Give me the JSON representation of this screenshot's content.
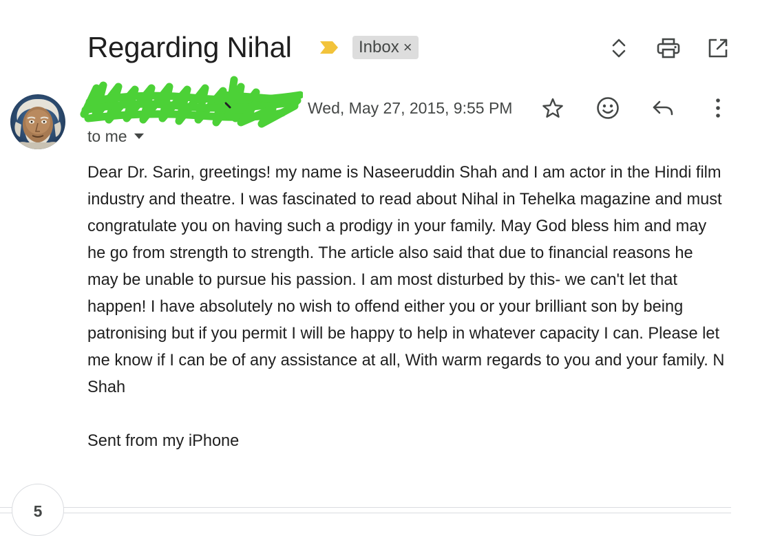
{
  "header": {
    "subject": "Regarding Nihal",
    "importance_icon": "importance-marker-icon",
    "importance_color": "#f2c33b",
    "label_chip": {
      "text": "Inbox",
      "remove_symbol": "×"
    },
    "actions": [
      {
        "name": "expand-collapse-icon"
      },
      {
        "name": "print-icon"
      },
      {
        "name": "open-new-window-icon"
      }
    ]
  },
  "message": {
    "sender_redacted": true,
    "redaction_color": "#4cd137",
    "date": "Wed, May 27, 2015, 9:55 PM",
    "recipient": "to me",
    "actions": [
      {
        "name": "star-icon"
      },
      {
        "name": "emoji-reaction-icon"
      },
      {
        "name": "reply-icon"
      },
      {
        "name": "more-options-icon"
      }
    ],
    "body": "Dear Dr. Sarin, greetings! my name is Naseeruddin Shah and I am actor in the Hindi film industry and theatre. I was fascinated to read about Nihal in Tehelka magazine and must congratulate you on having such a prodigy in your family. May God bless him and may he go from strength to strength. The article also said that due to financial reasons he may be unable to pursue his passion. I am most disturbed by this- we can't let that happen! I have absolutely no wish to offend either you or your brilliant son by being patronising but if you permit I will be happy to help in whatever capacity I can. Please let me know if I can be of any assistance at all, With warm regards to you and your family. N Shah",
    "signature": "Sent from my iPhone"
  },
  "thread": {
    "collapsed_count": "5"
  }
}
